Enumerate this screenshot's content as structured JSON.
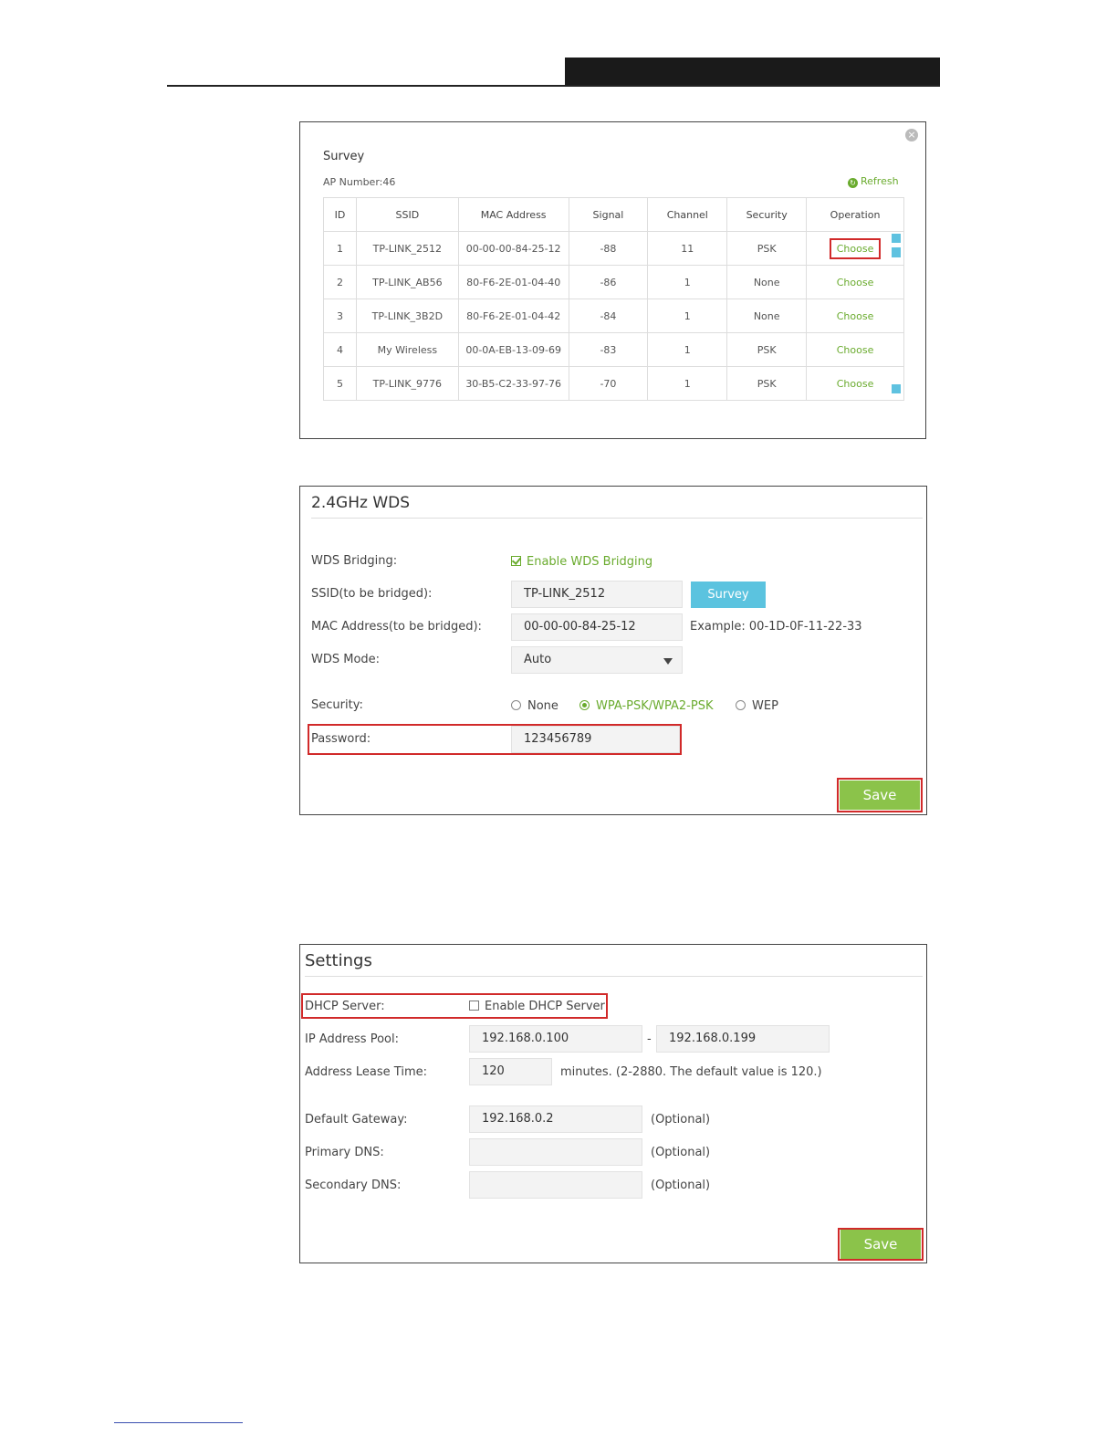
{
  "survey": {
    "title": "Survey",
    "ap_number": "AP Number:46",
    "refresh_label": "Refresh",
    "columns": [
      "ID",
      "SSID",
      "MAC Address",
      "Signal",
      "Channel",
      "Security",
      "Operation"
    ],
    "rows": [
      {
        "id": "1",
        "ssid": "TP-LINK_2512",
        "mac": "00-00-00-84-25-12",
        "signal": "-88",
        "channel": "11",
        "security": "PSK",
        "op": "Choose"
      },
      {
        "id": "2",
        "ssid": "TP-LINK_AB56",
        "mac": "80-F6-2E-01-04-40",
        "signal": "-86",
        "channel": "1",
        "security": "None",
        "op": "Choose"
      },
      {
        "id": "3",
        "ssid": "TP-LINK_3B2D",
        "mac": "80-F6-2E-01-04-42",
        "signal": "-84",
        "channel": "1",
        "security": "None",
        "op": "Choose"
      },
      {
        "id": "4",
        "ssid": "My Wireless",
        "mac": "00-0A-EB-13-09-69",
        "signal": "-83",
        "channel": "1",
        "security": "PSK",
        "op": "Choose"
      },
      {
        "id": "5",
        "ssid": "TP-LINK_9776",
        "mac": "30-B5-C2-33-97-76",
        "signal": "-70",
        "channel": "1",
        "security": "PSK",
        "op": "Choose"
      }
    ]
  },
  "wds": {
    "title": "2.4GHz WDS",
    "bridging_label": "WDS Bridging:",
    "bridging_checkbox": "Enable WDS Bridging",
    "ssid_label": "SSID(to be bridged):",
    "ssid_value": "TP-LINK_2512",
    "survey_button": "Survey",
    "mac_label": "MAC Address(to be bridged):",
    "mac_value": "00-00-00-84-25-12",
    "mac_example": "Example: 00-1D-0F-11-22-33",
    "mode_label": "WDS Mode:",
    "mode_value": "Auto",
    "security_label": "Security:",
    "security_options": [
      "None",
      "WPA-PSK/WPA2-PSK",
      "WEP"
    ],
    "password_label": "Password:",
    "password_value": "123456789",
    "save_label": "Save"
  },
  "settings": {
    "title": "Settings",
    "dhcp_label": "DHCP Server:",
    "dhcp_checkbox": "Enable DHCP Server",
    "pool_label": "IP Address Pool:",
    "pool_start": "192.168.0.100",
    "pool_sep": "-",
    "pool_end": "192.168.0.199",
    "lease_label": "Address Lease Time:",
    "lease_value": "120",
    "lease_note": "minutes. (2-2880. The default value is 120.)",
    "gateway_label": "Default Gateway:",
    "gateway_value": "192.168.0.2",
    "gateway_note": "(Optional)",
    "primary_dns_label": "Primary DNS:",
    "primary_dns_note": "(Optional)",
    "secondary_dns_label": "Secondary DNS:",
    "secondary_dns_note": "(Optional)",
    "save_label": "Save"
  }
}
